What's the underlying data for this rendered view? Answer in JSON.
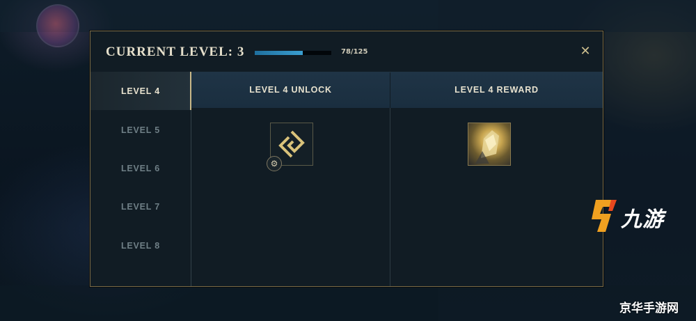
{
  "modal": {
    "title": "CURRENT LEVEL: 3",
    "xp_text": "78/125",
    "xp_progress": 0.624,
    "close_label": "✕"
  },
  "levels": [
    {
      "label": "LEVEL 4",
      "active": true
    },
    {
      "label": "LEVEL 5",
      "active": false
    },
    {
      "label": "LEVEL 6",
      "active": false
    },
    {
      "label": "LEVEL 7",
      "active": false
    },
    {
      "label": "LEVEL 8",
      "active": false
    }
  ],
  "columns": {
    "unlock_header": "LEVEL 4 UNLOCK",
    "reward_header": "LEVEL 4 REWARD"
  },
  "icons": {
    "unlock": "rune-emblem-icon",
    "unlock_badge": "settings-cog-icon",
    "reward": "champion-portrait-icon",
    "close": "close-icon"
  },
  "colors": {
    "accent_gold": "#c8b888",
    "xp_blue": "#2f8ac0",
    "panel_bg": "#111c24"
  },
  "watermark": {
    "brand": "九游",
    "site": "京华手游网"
  }
}
